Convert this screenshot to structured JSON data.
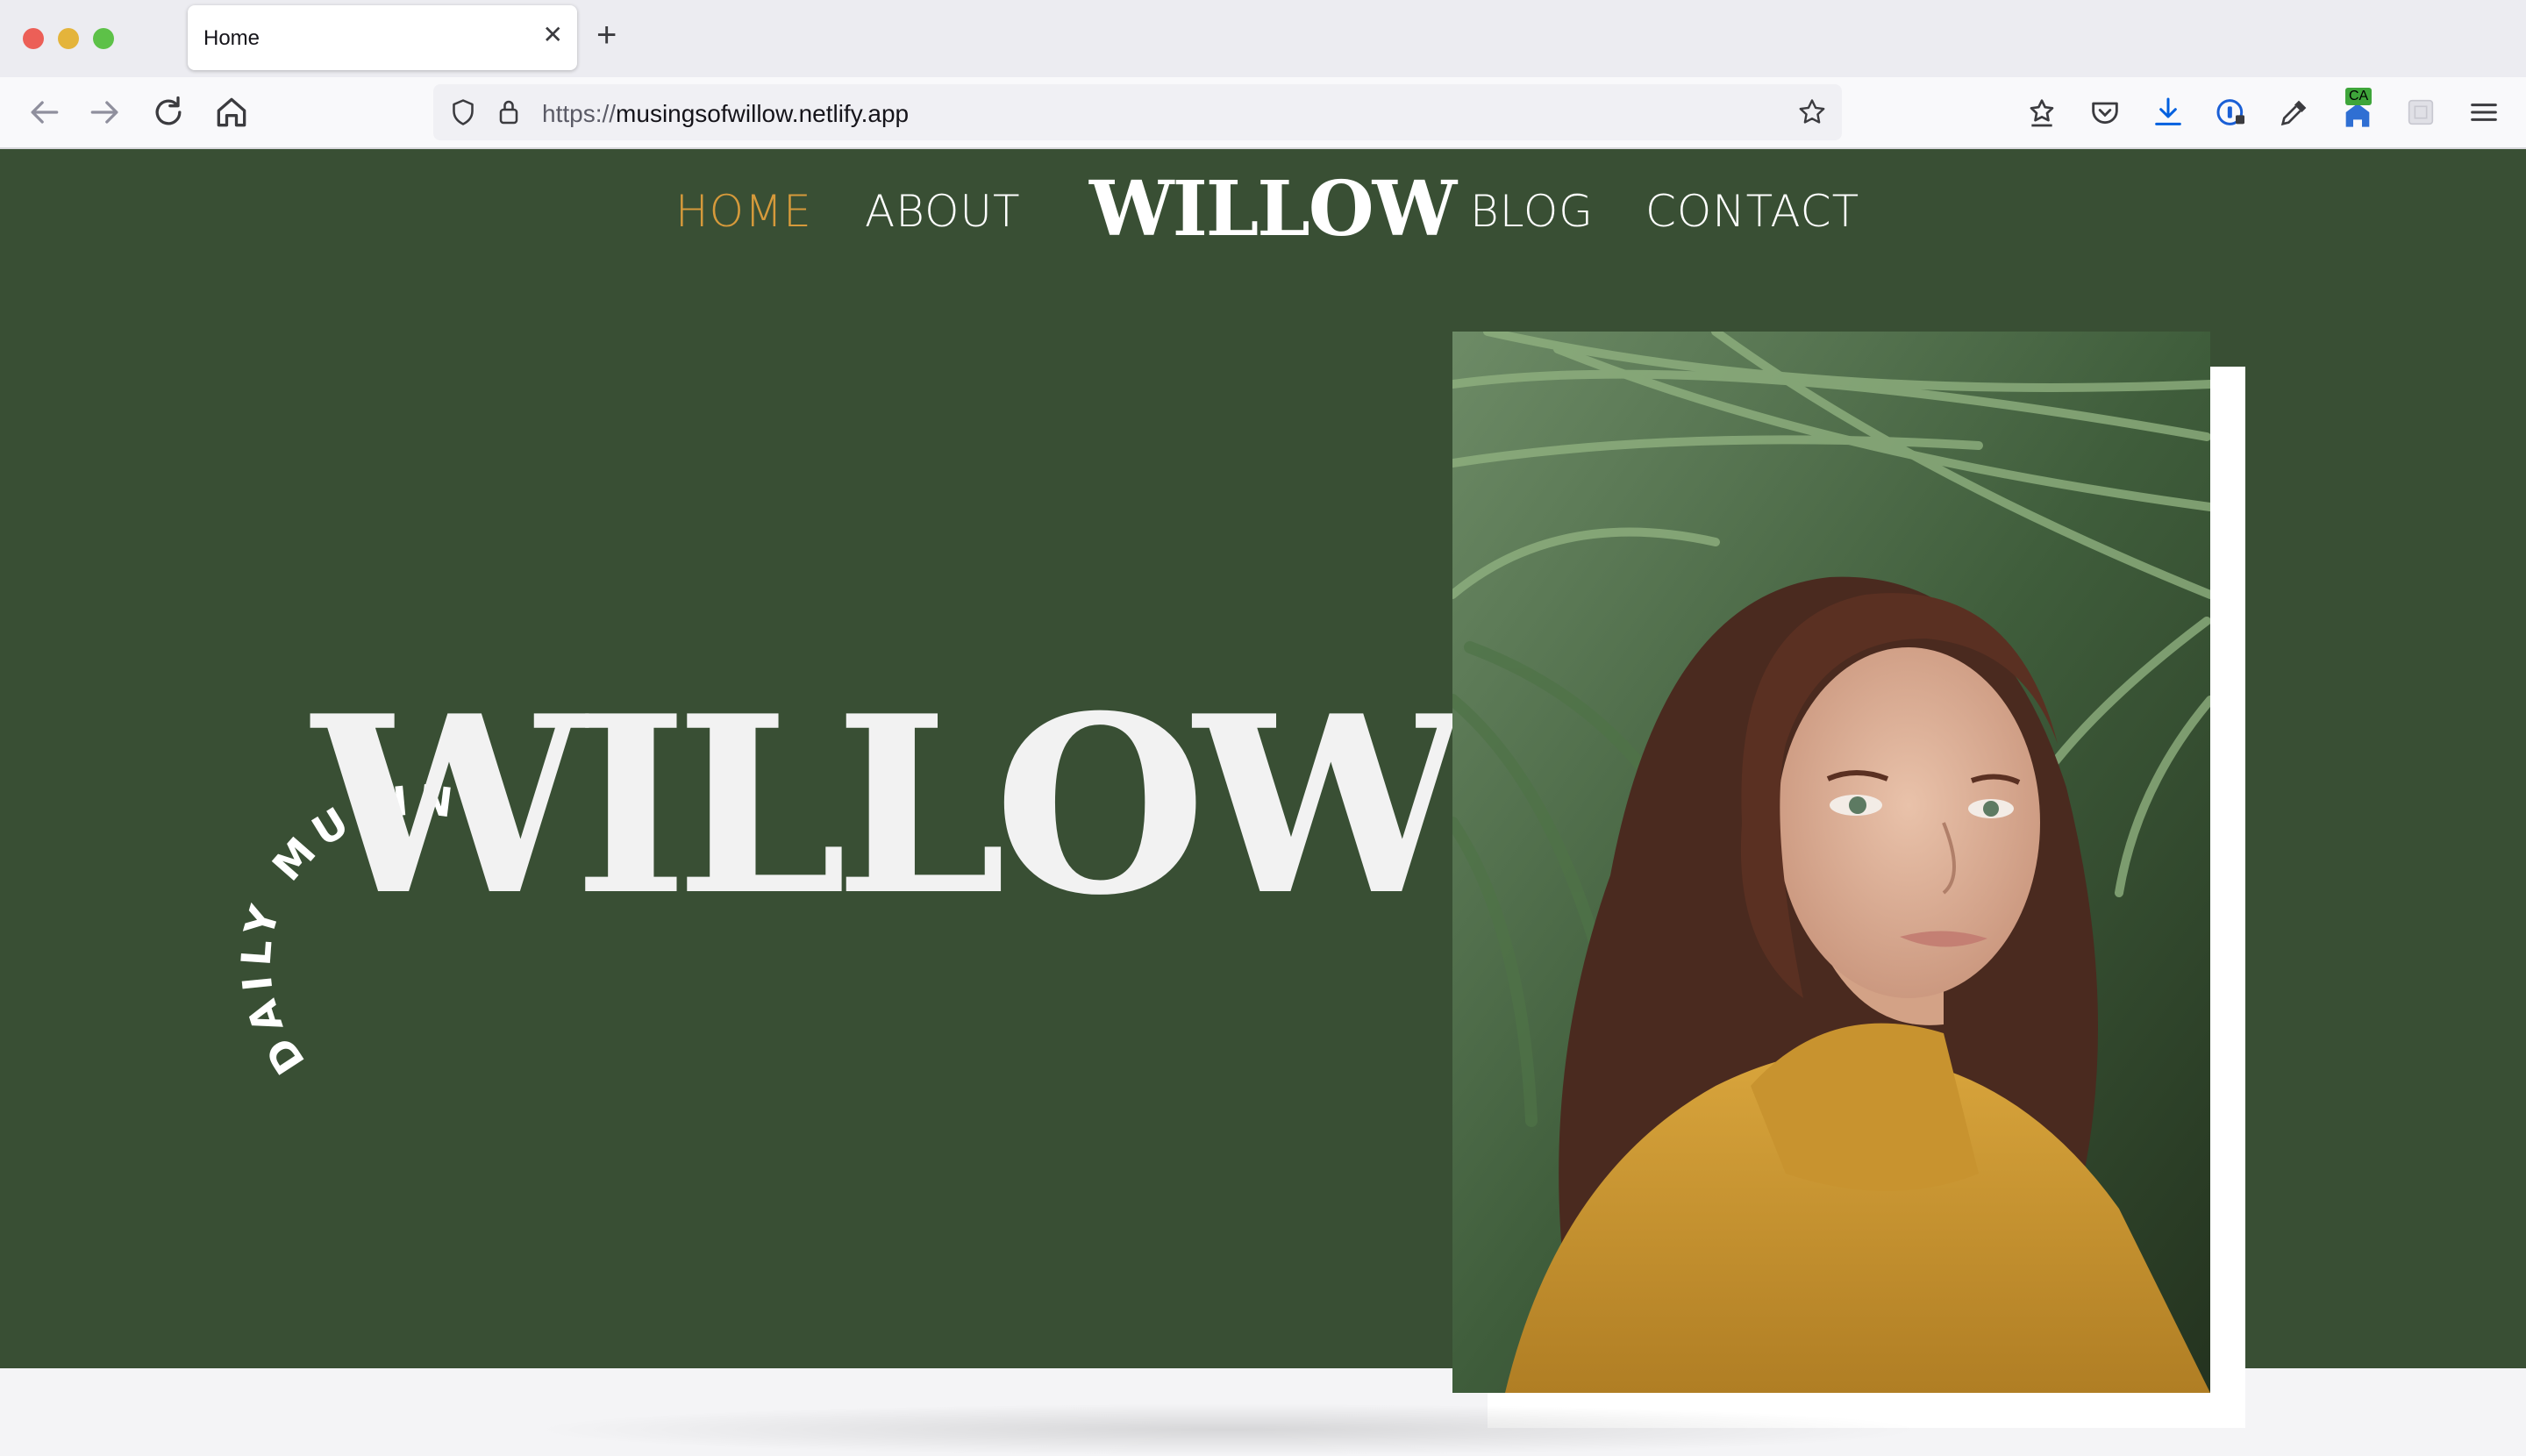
{
  "browser": {
    "tab_title": "Home",
    "url_protocol": "https://",
    "url_host": "musingsofwillow.netlify.app",
    "extension_badge": "CA"
  },
  "site": {
    "nav": {
      "home": "HOME",
      "about": "ABOUT",
      "logo": "WILLOW",
      "blog": "BLOG",
      "contact": "CONTACT"
    },
    "hero": {
      "arc_text": "DAILY MUSINGS OF",
      "title": "WILLOW"
    },
    "colors": {
      "hero_bg": "#394f34",
      "accent": "#d69a3b"
    }
  }
}
